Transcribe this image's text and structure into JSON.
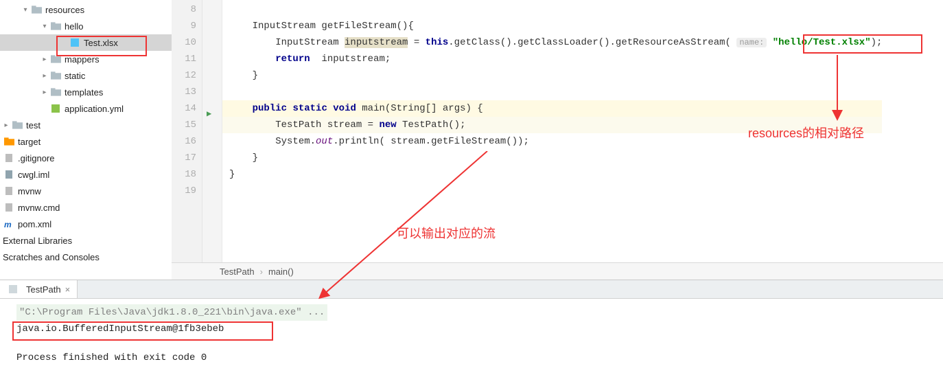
{
  "tree": {
    "resources": "resources",
    "hello": "hello",
    "test_xlsx": "Test.xlsx",
    "mappers": "mappers",
    "static": "static",
    "templates": "templates",
    "app_yml": "application.yml",
    "test": "test",
    "target": "target",
    "gitignore": ".gitignore",
    "cwgl_iml": "cwgl.iml",
    "mvnw": "mvnw",
    "mvnw_cmd": "mvnw.cmd",
    "pom_xml": "pom.xml",
    "ext_libs": "External Libraries",
    "scratches": "Scratches and Consoles"
  },
  "gutter": {
    "l8": "8",
    "l9": "9",
    "l10": "10",
    "l11": "11",
    "l12": "12",
    "l13": "13",
    "l14": "14",
    "l15": "15",
    "l16": "16",
    "l17": "17",
    "l18": "18",
    "l19": "19"
  },
  "code": {
    "l9_a": "    InputStream getFileStream(){",
    "l10_pre": "        InputStream ",
    "l10_var": "inputstream",
    "l10_mid": " = ",
    "l10_this": "this",
    "l10_rest": ".getClass().getClassLoader().getResourceAsStream( ",
    "l10_hint": "name:",
    "l10_sp": " ",
    "l10_str": "\"hello/Test.xlsx\"",
    "l10_end": ");",
    "l11_pre": "        ",
    "l11_ret": "return",
    "l11_rest": "  inputstream;",
    "l12": "    }",
    "l13": "",
    "l14_pre": "    ",
    "l14_pub": "public",
    "l14_sp1": " ",
    "l14_stat": "static",
    "l14_sp2": " ",
    "l14_void": "void",
    "l14_rest": " main(String[] args) {",
    "l15_pre": "        TestPath stream = ",
    "l15_new": "new",
    "l15_rest": " TestPath();",
    "l16_pre": "        System.",
    "l16_out": "out",
    "l16_rest": ".println( stream.getFileStream());",
    "l17": "    }",
    "l18": "}",
    "l19": ""
  },
  "breadcrumb": {
    "a": "TestPath",
    "b": "main()"
  },
  "run": {
    "tab": "TestPath",
    "cmd": "\"C:\\Program Files\\Java\\jdk1.8.0_221\\bin\\java.exe\" ...",
    "line": "java.io.BufferedInputStream@1fb3ebeb",
    "done": "Process finished with exit code 0"
  },
  "annotations": {
    "a1": "resources的相对路径",
    "a2": "可以输出对应的流"
  }
}
